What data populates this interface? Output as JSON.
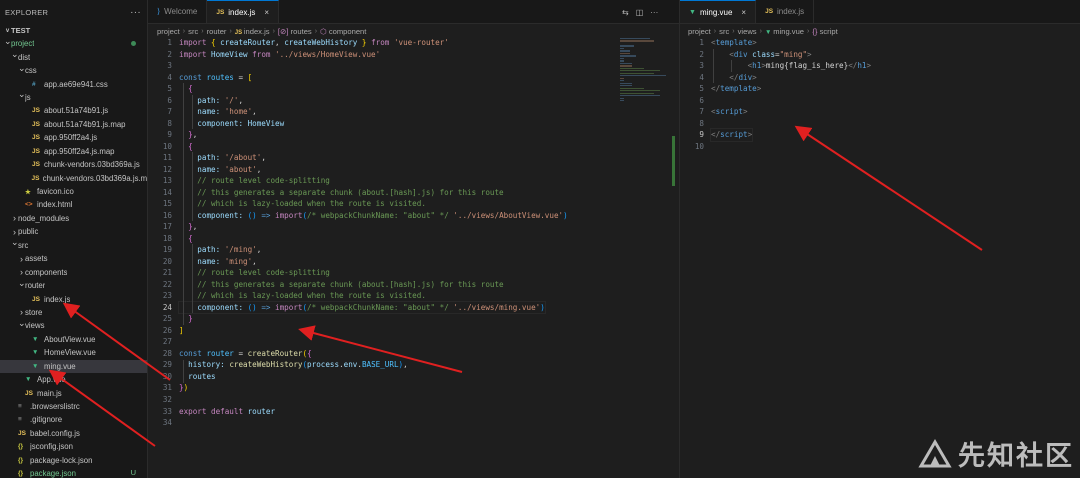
{
  "explorer": {
    "title": "EXPLORER",
    "more": "···",
    "section": "TEST",
    "rows": [
      {
        "label": "project",
        "indent": 0,
        "chev": "v",
        "icon": "",
        "green": true,
        "dot": true
      },
      {
        "label": "dist",
        "indent": 1,
        "chev": "v",
        "icon": ""
      },
      {
        "label": "css",
        "indent": 2,
        "chev": "v",
        "icon": ""
      },
      {
        "label": "app.ae69e941.css",
        "indent": 3,
        "chev": "",
        "icon": "css"
      },
      {
        "label": "js",
        "indent": 2,
        "chev": "v",
        "icon": ""
      },
      {
        "label": "about.51a74b91.js",
        "indent": 3,
        "chev": "",
        "icon": "js"
      },
      {
        "label": "about.51a74b91.js.map",
        "indent": 3,
        "chev": "",
        "icon": "js"
      },
      {
        "label": "app.950ff2a4.js",
        "indent": 3,
        "chev": "",
        "icon": "js"
      },
      {
        "label": "app.950ff2a4.js.map",
        "indent": 3,
        "chev": "",
        "icon": "js"
      },
      {
        "label": "chunk-vendors.03bd369a.js",
        "indent": 3,
        "chev": "",
        "icon": "js"
      },
      {
        "label": "chunk-vendors.03bd369a.js.map",
        "indent": 3,
        "chev": "",
        "icon": "js"
      },
      {
        "label": "favicon.ico",
        "indent": 2,
        "chev": "",
        "icon": "fav"
      },
      {
        "label": "index.html",
        "indent": 2,
        "chev": "",
        "icon": "html"
      },
      {
        "label": "node_modules",
        "indent": 1,
        "chev": ">",
        "icon": ""
      },
      {
        "label": "public",
        "indent": 1,
        "chev": ">",
        "icon": ""
      },
      {
        "label": "src",
        "indent": 1,
        "chev": "v",
        "icon": ""
      },
      {
        "label": "assets",
        "indent": 2,
        "chev": ">",
        "icon": ""
      },
      {
        "label": "components",
        "indent": 2,
        "chev": ">",
        "icon": ""
      },
      {
        "label": "router",
        "indent": 2,
        "chev": "v",
        "icon": ""
      },
      {
        "label": "index.js",
        "indent": 3,
        "chev": "",
        "icon": "js"
      },
      {
        "label": "store",
        "indent": 2,
        "chev": ">",
        "icon": ""
      },
      {
        "label": "views",
        "indent": 2,
        "chev": "v",
        "icon": ""
      },
      {
        "label": "AboutView.vue",
        "indent": 3,
        "chev": "",
        "icon": "vue"
      },
      {
        "label": "HomeView.vue",
        "indent": 3,
        "chev": "",
        "icon": "vue"
      },
      {
        "label": "ming.vue",
        "indent": 3,
        "chev": "",
        "icon": "vue",
        "selected": true
      },
      {
        "label": "App.vue",
        "indent": 2,
        "chev": "",
        "icon": "vue"
      },
      {
        "label": "main.js",
        "indent": 2,
        "chev": "",
        "icon": "js"
      },
      {
        "label": ".browserslistrc",
        "indent": 1,
        "chev": "",
        "icon": "dot"
      },
      {
        "label": ".gitignore",
        "indent": 1,
        "chev": "",
        "icon": "dot"
      },
      {
        "label": "babel.config.js",
        "indent": 1,
        "chev": "",
        "icon": "js"
      },
      {
        "label": "jsconfig.json",
        "indent": 1,
        "chev": "",
        "icon": "json"
      },
      {
        "label": "package-lock.json",
        "indent": 1,
        "chev": "",
        "icon": "json"
      },
      {
        "label": "package.json",
        "indent": 1,
        "chev": "",
        "icon": "json",
        "green": true,
        "badge": "U"
      }
    ]
  },
  "left_editor": {
    "tabs": [
      {
        "label": "Welcome",
        "icon": "vscode-icon",
        "glyph": "⟩",
        "active": false
      },
      {
        "label": "index.js",
        "icon": "js-icon",
        "glyph": "JS",
        "active": true,
        "close": "×"
      }
    ],
    "actions": [
      "⇆",
      "◫",
      "···"
    ],
    "breadcrumb": [
      {
        "text": "project"
      },
      {
        "text": "src"
      },
      {
        "text": "router"
      },
      {
        "text": "index.js",
        "icon": "JS"
      },
      {
        "text": "routes",
        "icon": "[⊘]"
      },
      {
        "text": "component",
        "icon": "⬡"
      }
    ],
    "current_line": 24,
    "lines": [
      [
        [
          "import ",
          "kw"
        ],
        [
          "{ ",
          "br1"
        ],
        [
          "createRouter",
          "vr"
        ],
        [
          ", ",
          ""
        ],
        [
          "createWebHistory",
          "vr"
        ],
        [
          " } ",
          "br1"
        ],
        [
          "from ",
          "kw"
        ],
        [
          "'vue-router'",
          "st"
        ]
      ],
      [
        [
          "import ",
          "kw"
        ],
        [
          "HomeView ",
          "vr"
        ],
        [
          "from ",
          "kw"
        ],
        [
          "'../views/HomeView.vue'",
          "st"
        ]
      ],
      [],
      [
        [
          "const ",
          "kb"
        ],
        [
          "routes ",
          "cs"
        ],
        [
          "= ",
          ""
        ],
        [
          "[",
          "br1"
        ]
      ],
      [
        [
          "  ",
          ""
        ],
        [
          "{",
          "br2"
        ]
      ],
      [
        [
          "    ",
          ""
        ],
        [
          "path: ",
          "vr"
        ],
        [
          "'/'",
          "st"
        ],
        [
          ",",
          ""
        ]
      ],
      [
        [
          "    ",
          ""
        ],
        [
          "name: ",
          "vr"
        ],
        [
          "'home'",
          "st"
        ],
        [
          ",",
          ""
        ]
      ],
      [
        [
          "    ",
          ""
        ],
        [
          "component: ",
          "vr"
        ],
        [
          "HomeView",
          "vr"
        ]
      ],
      [
        [
          "  ",
          ""
        ],
        [
          "}",
          "br2"
        ],
        [
          ",",
          ""
        ]
      ],
      [
        [
          "  ",
          ""
        ],
        [
          "{",
          "br2"
        ]
      ],
      [
        [
          "    ",
          ""
        ],
        [
          "path: ",
          "vr"
        ],
        [
          "'/about'",
          "st"
        ],
        [
          ",",
          ""
        ]
      ],
      [
        [
          "    ",
          ""
        ],
        [
          "name: ",
          "vr"
        ],
        [
          "'about'",
          "st"
        ],
        [
          ",",
          ""
        ]
      ],
      [
        [
          "    ",
          ""
        ],
        [
          "// route level code-splitting",
          "cm"
        ]
      ],
      [
        [
          "    ",
          ""
        ],
        [
          "// this generates a separate chunk (about.[hash].js) for this route",
          "cm"
        ]
      ],
      [
        [
          "    ",
          ""
        ],
        [
          "// which is lazy-loaded when the route is visited.",
          "cm"
        ]
      ],
      [
        [
          "    ",
          ""
        ],
        [
          "component: ",
          "vr"
        ],
        [
          "() ",
          "br3"
        ],
        [
          "=> ",
          "kb"
        ],
        [
          "import",
          "kw"
        ],
        [
          "(",
          "br3"
        ],
        [
          "/* webpackChunkName: \"about\" */ ",
          "cm"
        ],
        [
          "'../views/AboutView.vue'",
          "st"
        ],
        [
          ")",
          "br3"
        ]
      ],
      [
        [
          "  ",
          ""
        ],
        [
          "}",
          "br2"
        ],
        [
          ",",
          ""
        ]
      ],
      [
        [
          "  ",
          ""
        ],
        [
          "{",
          "br2"
        ]
      ],
      [
        [
          "    ",
          ""
        ],
        [
          "path: ",
          "vr"
        ],
        [
          "'/ming'",
          "st"
        ],
        [
          ",",
          ""
        ]
      ],
      [
        [
          "    ",
          ""
        ],
        [
          "name: ",
          "vr"
        ],
        [
          "'ming'",
          "st"
        ],
        [
          ",",
          ""
        ]
      ],
      [
        [
          "    ",
          ""
        ],
        [
          "// route level code-splitting",
          "cm"
        ]
      ],
      [
        [
          "    ",
          ""
        ],
        [
          "// this generates a separate chunk (about.[hash].js) for this route",
          "cm"
        ]
      ],
      [
        [
          "    ",
          ""
        ],
        [
          "// which is lazy-loaded when the route is visited.",
          "cm"
        ]
      ],
      [
        [
          "    ",
          ""
        ],
        [
          "component: ",
          "vr"
        ],
        [
          "() ",
          "br3"
        ],
        [
          "=> ",
          "kb"
        ],
        [
          "import",
          "kw"
        ],
        [
          "(",
          "br3"
        ],
        [
          "/* webpackChunkName: \"about\" */ ",
          "cm"
        ],
        [
          "'../views/ming.vue'",
          "st"
        ],
        [
          ")",
          "br3"
        ]
      ],
      [
        [
          "  ",
          ""
        ],
        [
          "}",
          "br2"
        ]
      ],
      [
        [
          "]",
          "br1"
        ]
      ],
      [],
      [
        [
          "const ",
          "kb"
        ],
        [
          "router ",
          "cs"
        ],
        [
          "= ",
          ""
        ],
        [
          "createRouter",
          "fn"
        ],
        [
          "(",
          "br1"
        ],
        [
          "{",
          "br2"
        ]
      ],
      [
        [
          "  ",
          ""
        ],
        [
          "history: ",
          "vr"
        ],
        [
          "createWebHistory",
          "fn"
        ],
        [
          "(",
          "br3"
        ],
        [
          "process",
          "vr"
        ],
        [
          ".",
          ""
        ],
        [
          "env",
          "vr"
        ],
        [
          ".",
          ""
        ],
        [
          "BASE_URL",
          "cs"
        ],
        [
          ")",
          "br3"
        ],
        [
          ",",
          ""
        ]
      ],
      [
        [
          "  ",
          ""
        ],
        [
          "routes",
          "vr"
        ]
      ],
      [
        [
          "}",
          "br2"
        ],
        [
          ")",
          "br1"
        ]
      ],
      [],
      [
        [
          "export ",
          "kw"
        ],
        [
          "default ",
          "kw"
        ],
        [
          "router",
          "vr"
        ]
      ],
      []
    ]
  },
  "right_editor": {
    "tabs": [
      {
        "label": "ming.vue",
        "icon": "vue-icon",
        "glyph": "▼",
        "active": true,
        "close": "×"
      },
      {
        "label": "index.js",
        "icon": "js-icon",
        "glyph": "JS",
        "active": false
      }
    ],
    "breadcrumb": [
      {
        "text": "project"
      },
      {
        "text": "src"
      },
      {
        "text": "views"
      },
      {
        "text": "ming.vue",
        "icon": "▼"
      },
      {
        "text": "script",
        "icon": "{}"
      }
    ],
    "current_line": 9,
    "lines": [
      [
        [
          "<",
          "pn"
        ],
        [
          "template",
          "tg"
        ],
        [
          ">",
          "pn"
        ]
      ],
      [
        [
          "    ",
          ""
        ],
        [
          "<",
          "pn"
        ],
        [
          "div ",
          "tg"
        ],
        [
          "class",
          "at"
        ],
        [
          "=",
          ""
        ],
        [
          "\"ming\"",
          "st"
        ],
        [
          ">",
          "pn"
        ]
      ],
      [
        [
          "        ",
          ""
        ],
        [
          "<",
          "pn"
        ],
        [
          "h1",
          "tg"
        ],
        [
          ">",
          "pn"
        ],
        [
          "ming{flag_is_here}",
          ""
        ],
        [
          "</",
          "pn"
        ],
        [
          "h1",
          "tg"
        ],
        [
          ">",
          "pn"
        ]
      ],
      [
        [
          "    ",
          ""
        ],
        [
          "</",
          "pn"
        ],
        [
          "div",
          "tg"
        ],
        [
          ">",
          "pn"
        ]
      ],
      [
        [
          "</",
          "pn"
        ],
        [
          "template",
          "tg"
        ],
        [
          ">",
          "pn"
        ]
      ],
      [],
      [
        [
          "<",
          "pn"
        ],
        [
          "script",
          "tg"
        ],
        [
          ">",
          "pn"
        ]
      ],
      [],
      [
        [
          "</",
          "pn"
        ],
        [
          "script",
          "tg"
        ],
        [
          ">",
          "pn"
        ]
      ],
      []
    ]
  },
  "watermark": {
    "text": "先知社区",
    "logo": "xianzhi-logo"
  }
}
